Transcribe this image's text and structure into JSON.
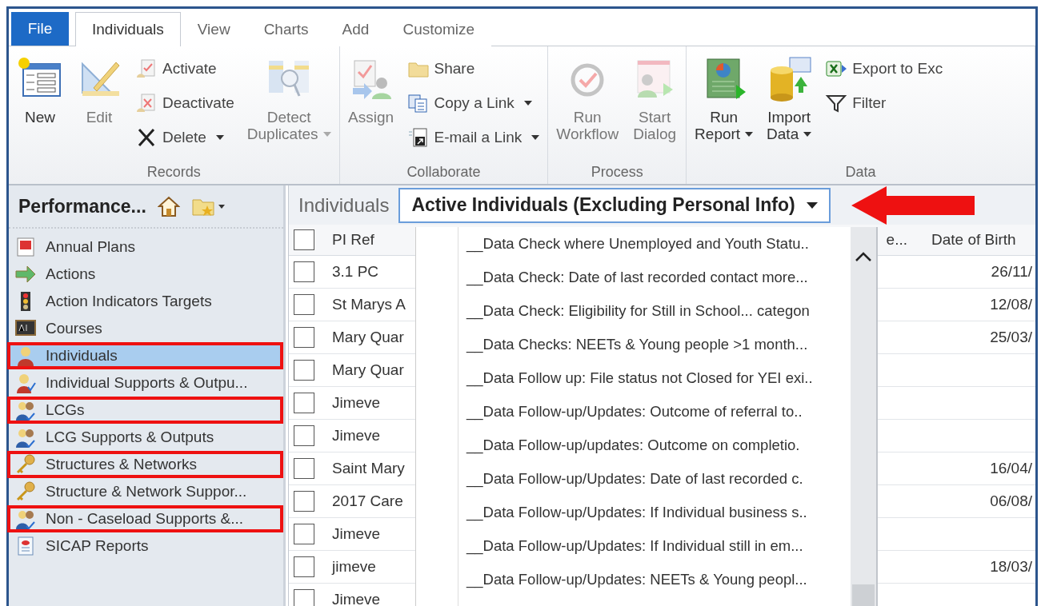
{
  "ribbon": {
    "file_tab": "File",
    "tabs": [
      {
        "label": "Individuals",
        "selected": true
      },
      {
        "label": "View",
        "selected": false
      },
      {
        "label": "Charts",
        "selected": false
      },
      {
        "label": "Add",
        "selected": false
      },
      {
        "label": "Customize",
        "selected": false
      }
    ],
    "groups": [
      {
        "label": "Records",
        "items": [
          {
            "kind": "large",
            "lines": [
              "New"
            ],
            "disabled": false,
            "menu": false
          },
          {
            "kind": "large",
            "lines": [
              "Edit"
            ],
            "disabled": true,
            "menu": false
          },
          {
            "kind": "stack",
            "buttons": [
              {
                "label": "Activate",
                "menu": false
              },
              {
                "label": "Deactivate",
                "menu": false
              },
              {
                "label": "Delete",
                "menu": true
              }
            ]
          },
          {
            "kind": "large",
            "lines": [
              "Detect",
              "Duplicates"
            ],
            "disabled": true,
            "menu": true
          }
        ]
      },
      {
        "label": "Collaborate",
        "items": [
          {
            "kind": "large",
            "lines": [
              "Assign"
            ],
            "disabled": true,
            "menu": false
          },
          {
            "kind": "stack",
            "buttons": [
              {
                "label": "Share",
                "menu": false
              },
              {
                "label": "Copy a Link",
                "menu": true
              },
              {
                "label": "E-mail a Link",
                "menu": true
              }
            ]
          }
        ]
      },
      {
        "label": "Process",
        "items": [
          {
            "kind": "large",
            "lines": [
              "Run",
              "Workflow"
            ],
            "disabled": true,
            "menu": false
          },
          {
            "kind": "large",
            "lines": [
              "Start",
              "Dialog"
            ],
            "disabled": true,
            "menu": false
          }
        ]
      },
      {
        "label": "Data",
        "items": [
          {
            "kind": "large",
            "lines": [
              "Run",
              "Report"
            ],
            "disabled": false,
            "menu": true
          },
          {
            "kind": "large",
            "lines": [
              "Import",
              "Data"
            ],
            "disabled": false,
            "menu": true
          },
          {
            "kind": "stack",
            "buttons": [
              {
                "label": "Export to Exc",
                "menu": false
              },
              {
                "label": "Filter",
                "menu": false
              }
            ]
          }
        ]
      }
    ]
  },
  "sidebar": {
    "title": "Performance...",
    "items": [
      {
        "label": "Annual Plans",
        "selected": false,
        "highlighted": false
      },
      {
        "label": "Actions",
        "selected": false,
        "highlighted": false
      },
      {
        "label": "Action Indicators Targets",
        "selected": false,
        "highlighted": false
      },
      {
        "label": "Courses",
        "selected": false,
        "highlighted": false
      },
      {
        "label": "Individuals",
        "selected": true,
        "highlighted": true
      },
      {
        "label": "Individual Supports & Outpu...",
        "selected": false,
        "highlighted": false
      },
      {
        "label": "LCGs",
        "selected": false,
        "highlighted": true
      },
      {
        "label": "LCG Supports & Outputs",
        "selected": false,
        "highlighted": false
      },
      {
        "label": "Structures & Networks",
        "selected": false,
        "highlighted": true
      },
      {
        "label": "Structure & Network Suppor...",
        "selected": false,
        "highlighted": false
      },
      {
        "label": "Non - Caseload Supports &...",
        "selected": false,
        "highlighted": true
      },
      {
        "label": "SICAP Reports",
        "selected": false,
        "highlighted": false
      }
    ]
  },
  "view": {
    "entity": "Individuals",
    "selector": "Active Individuals (Excluding Personal Info)",
    "options": [
      "__Data Check where Unemployed and Youth Statu..",
      "__Data Check: Date of last recorded contact more...",
      "__Data Check: Eligibility for Still in School... categon",
      "__Data Checks: NEETs & Young people >1 month...",
      "__Data Follow up: File status not Closed for YEI exi..",
      "__Data Follow-up/Updates: Outcome of referral to..",
      "__Data Follow-up/updates: Outcome on completio.",
      "__Data Follow-up/Updates: Date of last recorded c.",
      "__Data Follow-up/Updates: If Individual business s..",
      "__Data Follow-up/Updates: If Individual still in em...",
      "__Data Follow-up/Updates: NEETs & Young peopl..."
    ]
  },
  "grid": {
    "header_checked": false,
    "columns": [
      "PI Ref",
      "e...",
      "Date of Birth"
    ],
    "rows": [
      {
        "pi_ref": "3.1 PC",
        "date_of_birth": "26/11/",
        "checked": false
      },
      {
        "pi_ref": "St Marys A",
        "date_of_birth": "12/08/",
        "checked": false
      },
      {
        "pi_ref": "Mary Quar",
        "date_of_birth": "25/03/",
        "checked": false
      },
      {
        "pi_ref": "Mary Quar",
        "checked": false
      },
      {
        "pi_ref": "Jimeve",
        "checked": false
      },
      {
        "pi_ref": "Jimeve",
        "checked": false
      },
      {
        "pi_ref": "Saint Mary",
        "date_of_birth": "16/04/",
        "checked": false
      },
      {
        "pi_ref": "2017 Care",
        "date_of_birth": "06/08/",
        "checked": false
      },
      {
        "pi_ref": "Jimeve",
        "checked": false
      },
      {
        "pi_ref": "jimeve",
        "date_of_birth": "18/03/",
        "checked": false
      },
      {
        "pi_ref": "Jimeve",
        "checked": false
      }
    ]
  }
}
